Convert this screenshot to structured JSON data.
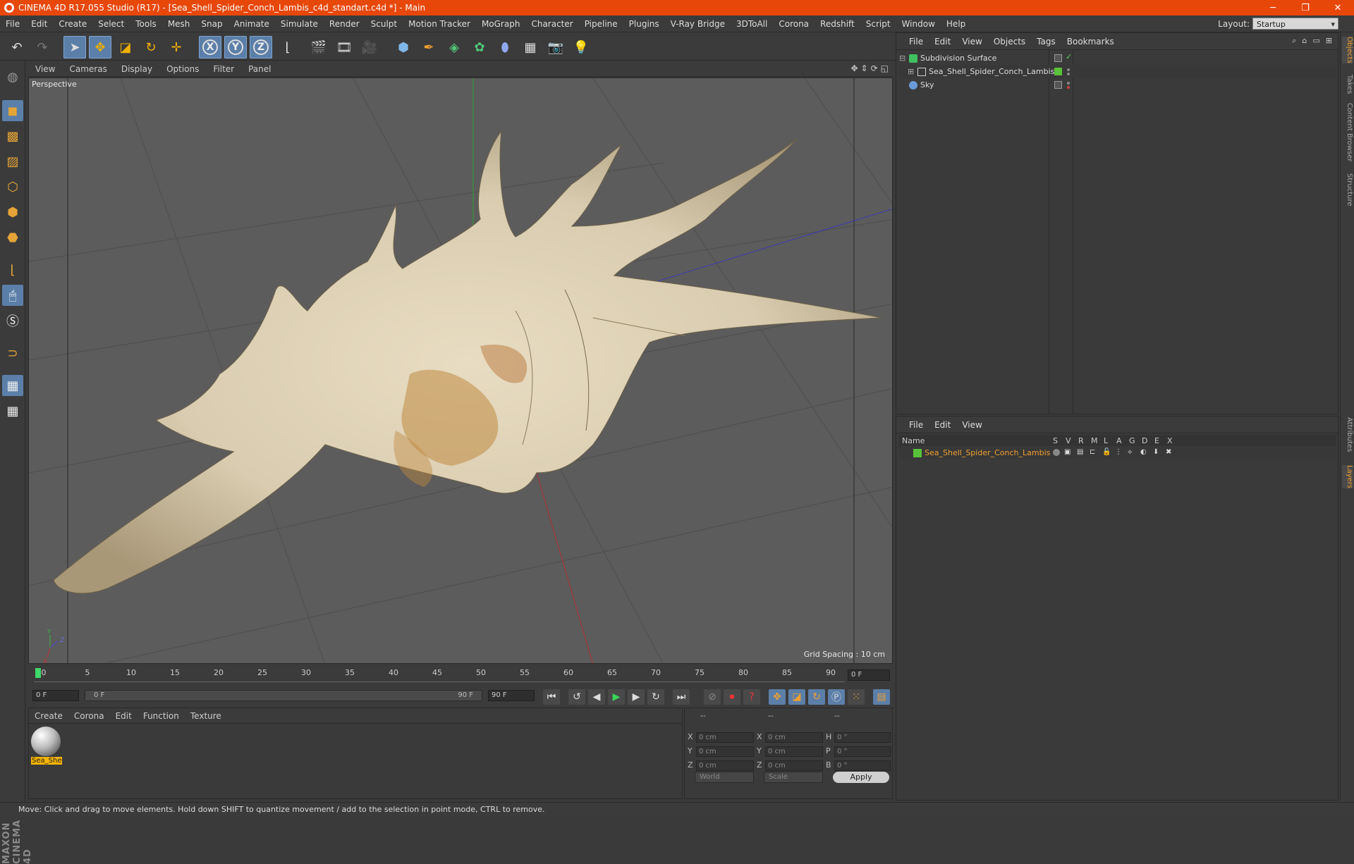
{
  "window": {
    "title": "CINEMA 4D R17.055 Studio (R17) - [Sea_Shell_Spider_Conch_Lambis_c4d_standart.c4d *] - Main",
    "min": "─",
    "max": "❐",
    "close": "✕"
  },
  "menu": [
    "File",
    "Edit",
    "Create",
    "Select",
    "Tools",
    "Mesh",
    "Snap",
    "Animate",
    "Simulate",
    "Render",
    "Sculpt",
    "Motion Tracker",
    "MoGraph",
    "Character",
    "Pipeline",
    "Plugins",
    "V-Ray Bridge",
    "3DToAll",
    "Corona",
    "Redshift",
    "Script",
    "Window",
    "Help"
  ],
  "layout": {
    "label": "Layout:",
    "value": "Startup"
  },
  "toolbar": {
    "axis_x": "X",
    "axis_y": "Y",
    "axis_z": "Z"
  },
  "viewport": {
    "menu": [
      "View",
      "Cameras",
      "Display",
      "Options",
      "Filter",
      "Panel"
    ],
    "label": "Perspective",
    "grid_spacing": "Grid Spacing : 10 cm",
    "axis_y": "Y",
    "axis_z": "Z",
    "axis_x": "X"
  },
  "timeline": {
    "ticks": [
      "0",
      "5",
      "10",
      "15",
      "20",
      "25",
      "30",
      "35",
      "40",
      "45",
      "50",
      "55",
      "60",
      "65",
      "70",
      "75",
      "80",
      "85",
      "90"
    ],
    "end_field": "0 F"
  },
  "transport": {
    "start_field": "0 F",
    "slider_start": "0 F",
    "slider_end": "90 F",
    "end_field": "90 F"
  },
  "materials": {
    "menu": [
      "Create",
      "Corona",
      "Edit",
      "Function",
      "Texture"
    ],
    "items": [
      {
        "name": "Sea_She"
      }
    ]
  },
  "coords": {
    "headers": [
      "--",
      "--",
      "--"
    ],
    "rows": [
      {
        "l1": "X",
        "v1": "0 cm",
        "l2": "X",
        "v2": "0 cm",
        "l3": "H",
        "v3": "0 °"
      },
      {
        "l1": "Y",
        "v1": "0 cm",
        "l2": "Y",
        "v2": "0 cm",
        "l3": "P",
        "v3": "0 °"
      },
      {
        "l1": "Z",
        "v1": "0 cm",
        "l2": "Z",
        "v2": "0 cm",
        "l3": "B",
        "v3": "0 °"
      }
    ],
    "world": "World",
    "scale": "Scale",
    "apply": "Apply"
  },
  "objects": {
    "menu": [
      "File",
      "Edit",
      "View",
      "Objects",
      "Tags",
      "Bookmarks"
    ],
    "items": [
      {
        "name": "Subdivision Surface",
        "color": "#3fc060"
      },
      {
        "name": "Sea_Shell_Spider_Conch_Lambis",
        "color": "#aaaaaa"
      },
      {
        "name": "Sky",
        "color": "#6a9ad8"
      }
    ]
  },
  "layers": {
    "menu": [
      "File",
      "Edit",
      "View"
    ],
    "columns": [
      "Name",
      "S",
      "V",
      "R",
      "M",
      "L",
      "A",
      "G",
      "D",
      "E",
      "X"
    ],
    "items": [
      {
        "name": "Sea_Shell_Spider_Conch_Lambis",
        "color": "#58c23a"
      }
    ]
  },
  "sidetabs": [
    "Objects",
    "Takes",
    "Content Browser",
    "Structure",
    "Attributes",
    "Layers"
  ],
  "brand": "MAXON CINEMA 4D",
  "status": "Move: Click and drag to move elements. Hold down SHIFT to quantize movement / add to the selection in point mode, CTRL to remove."
}
